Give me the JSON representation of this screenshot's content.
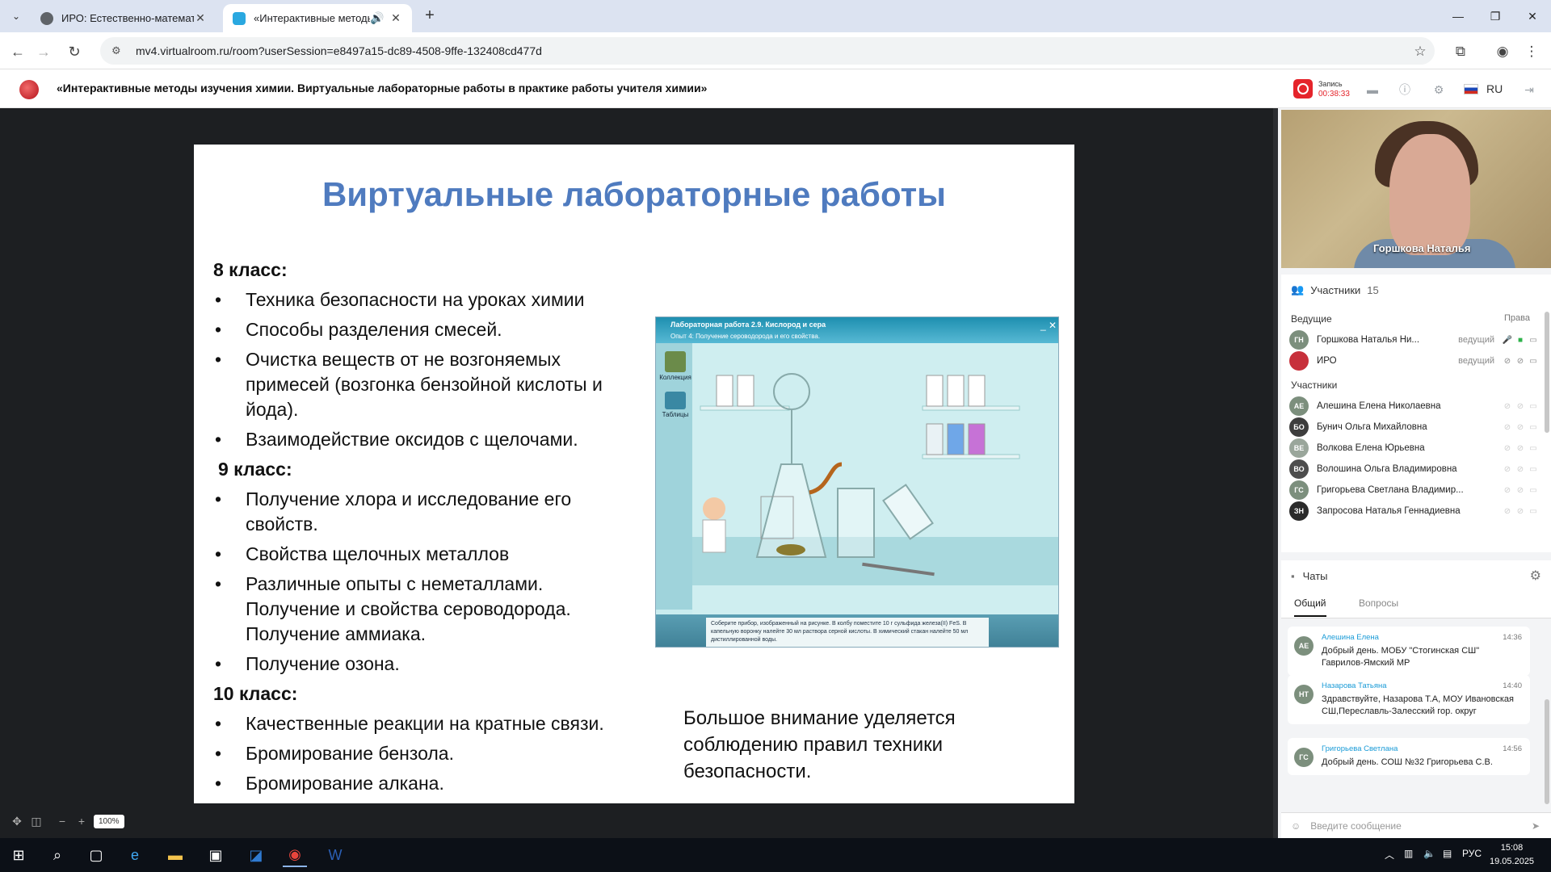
{
  "browser": {
    "tabs": [
      {
        "title": "ИРО: Естественно-математич...",
        "active": false
      },
      {
        "title": "«Интерактивные методы и...",
        "active": true
      }
    ],
    "url": "mv4.virtualroom.ru/room?userSession=e8497a15-dc89-4508-9ffe-132408cd477d"
  },
  "app": {
    "title": "«Интерактивные методы изучения химии. Виртуальные лабораторные работы в практике работы учителя химии»",
    "record_label": "Запись",
    "record_time": "00:38:33",
    "language": "RU"
  },
  "slide": {
    "title": "Виртуальные лабораторные работы",
    "sections": [
      {
        "grade": "8 класс:",
        "items": [
          "Техника безопасности на уроках химии",
          "Способы разделения смесей.",
          "Очистка веществ от не возгоняемых примесей (возгонка бензойной кислоты и йода).",
          "Взаимодействие оксидов с щелочами."
        ]
      },
      {
        "grade": "9 класс:",
        "items": [
          "Получение хлора и исследование его свойств.",
          "Свойства щелочных металлов",
          "Различные опыты с неметаллами. Получение и свойства сероводорода. Получение аммиака.",
          "Получение озона."
        ]
      },
      {
        "grade": "10 класс:",
        "items": [
          "Качественные реакции на кратные связи.",
          "Бромирование бензола.",
          "Бромирование алкана."
        ]
      }
    ],
    "note": "Большое внимание уделяется соблюдению правил техники безопасности.",
    "lab": {
      "title": "Лабораторная работа 2.9. Кислород и сера",
      "subtitle": "Опыт 4: Получение сероводорода и его свойства.",
      "side_items": [
        "Коллекция",
        "Таблицы"
      ],
      "instructions": "Соберите прибор, изображенный на рисунке. В колбу поместите 10 г сульфида железа(II) FeS. В капельную воронку налейте 30 мл раствора серной кислоты. В химический стакан налейте 50 мл дистиллированной воды."
    }
  },
  "video": {
    "name": "Горшкова Наталья"
  },
  "participants": {
    "label": "Участники",
    "count": "15",
    "hosts_label": "Ведущие",
    "rights_label": "Права",
    "hosts": [
      {
        "initials": "ГН",
        "name": "Горшкова Наталья Ни...",
        "role": "ведущий",
        "color": "#7c8f7d"
      },
      {
        "initials": "",
        "name": "ИРО",
        "role": "ведущий",
        "color": "#c7303b"
      }
    ],
    "members_label": "Участники",
    "members": [
      {
        "initials": "АЕ",
        "name": "Алешина Елена Николаевна",
        "color": "#7c8f7d"
      },
      {
        "initials": "БО",
        "name": "Бунич Ольга Михайловна",
        "color": "#3d3d3d"
      },
      {
        "initials": "ВЕ",
        "name": "Волкова Елена Юрьевна",
        "color": "#9aa69b"
      },
      {
        "initials": "ВО",
        "name": "Волошина Ольга Владимировна",
        "color": "#4d4d4d"
      },
      {
        "initials": "ГС",
        "name": "Григорьева Светлана Владимир...",
        "color": "#7c8f7d"
      },
      {
        "initials": "ЗН",
        "name": "Запросова Наталья Геннадиевна",
        "color": "#2b2b2b"
      }
    ]
  },
  "chat": {
    "label": "Чаты",
    "tabs": [
      "Общий",
      "Вопросы"
    ],
    "messages": [
      {
        "initials": "АЕ",
        "author": "Алешина Елена",
        "time": "14:36",
        "text": "Добрый день. МОБУ \"Стогинская СШ\" Гаврилов-Ямский МР"
      },
      {
        "initials": "НТ",
        "author": "Назарова Татьяна",
        "time": "14:40",
        "text": "Здравствуйте, Назарова Т.А, МОУ Ивановская СШ,Переславль-Залесский гор. округ"
      },
      {
        "initials": "ГС",
        "author": "Григорьева Светлана",
        "time": "14:56",
        "text": "Добрый день. СОШ №32 Григорьева С.В."
      }
    ],
    "input_placeholder": "Введите сообщение"
  },
  "zoom": {
    "value": "100%"
  },
  "taskbar": {
    "lang": "РУС",
    "time": "15:08",
    "date": "19.05.2025"
  }
}
